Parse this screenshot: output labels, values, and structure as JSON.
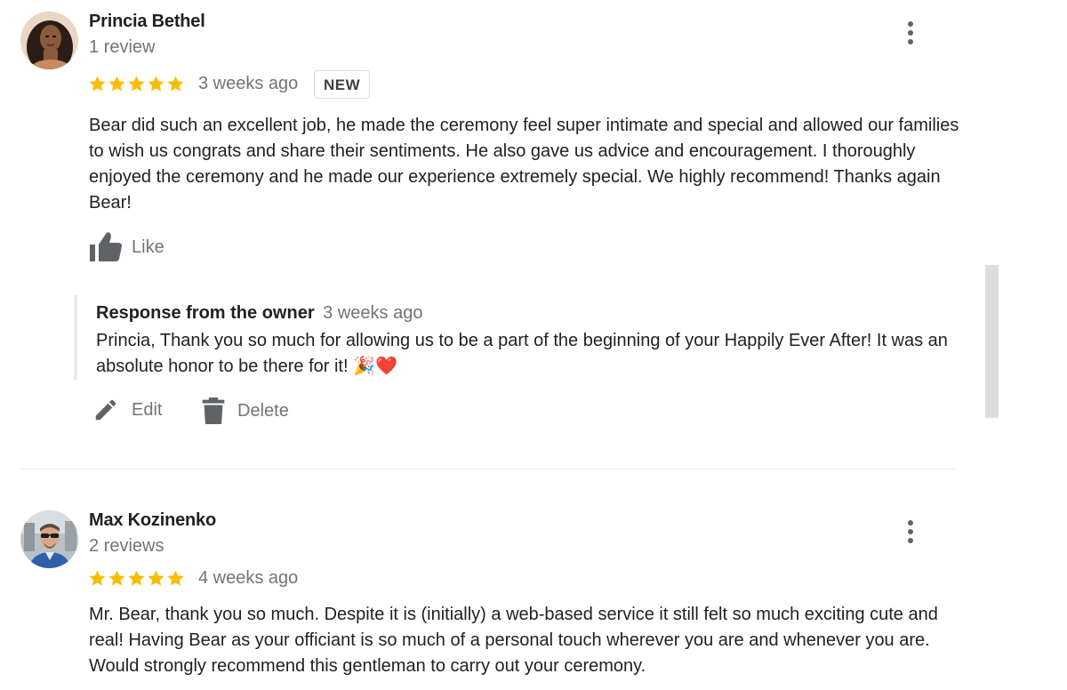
{
  "reviews": [
    {
      "author": "Princia Bethel",
      "review_count": "1 review",
      "rating": 5,
      "date": "3 weeks ago",
      "badge": "NEW",
      "text": "Bear did such an excellent job, he made the ceremony feel super intimate and special and allowed our families to wish us congrats and share their sentiments. He also gave us advice and encouragement. I thoroughly enjoyed the ceremony and he made our experience extremely special. We highly recommend! Thanks again Bear!",
      "like_label": "Like",
      "owner_response": {
        "title": "Response from the owner",
        "date": "3 weeks ago",
        "text": "Princia, Thank you so much for allowing us to be a part of the beginning of your Happily Ever After! It was an absolute honor to be there for it! 🎉❤️"
      },
      "actions": {
        "edit_label": "Edit",
        "delete_label": "Delete"
      }
    },
    {
      "author": "Max Kozinenko",
      "review_count": "2 reviews",
      "rating": 5,
      "date": "4 weeks ago",
      "text": "Mr. Bear, thank you so much. Despite it is (initially) a web-based service it still felt so much exciting cute and real! Having Bear as your officiant is so much of a personal touch wherever you are and whenever you are. Would strongly recommend this gentleman to carry out your ceremony."
    }
  ],
  "colors": {
    "star": "#fbbc04",
    "text_primary": "#202124",
    "text_secondary": "#70757a",
    "icon": "#5f6368"
  },
  "icons": {
    "more": "more-vert-icon",
    "like": "thumb-up-icon",
    "edit": "pencil-icon",
    "delete": "trash-icon",
    "star": "star-icon"
  }
}
